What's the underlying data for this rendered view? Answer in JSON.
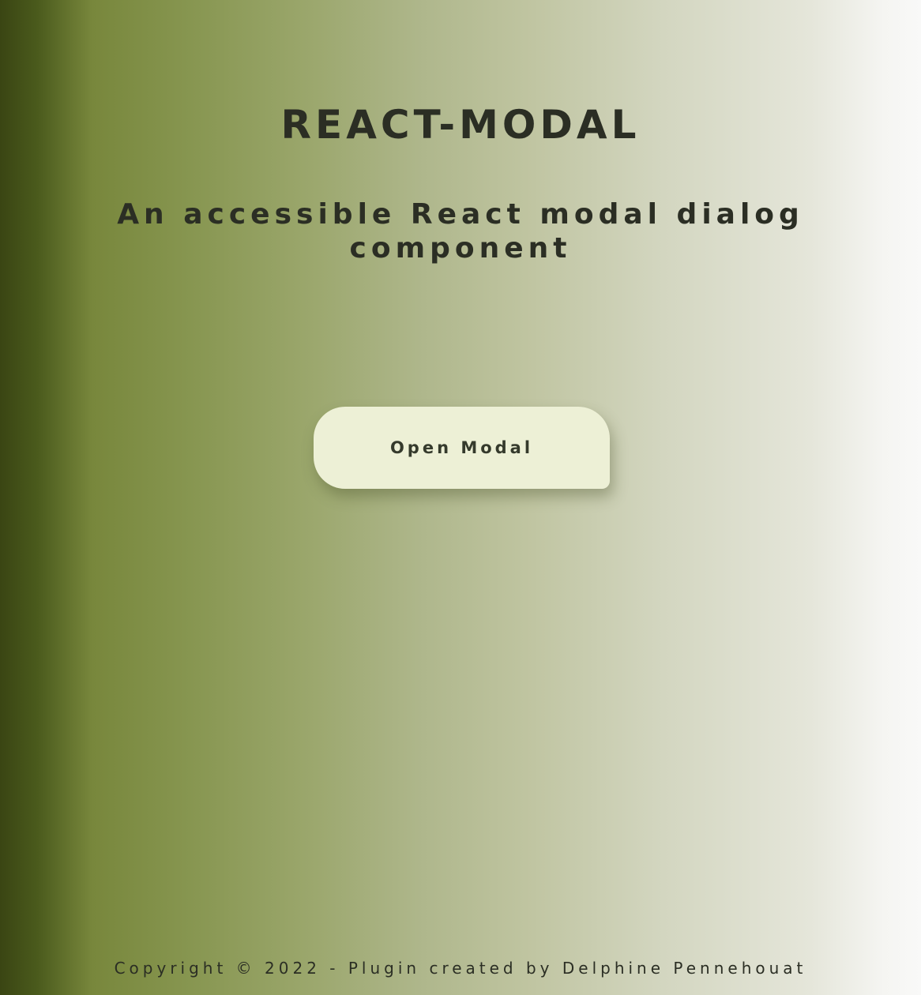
{
  "header": {
    "title": "REACT-MODAL",
    "subtitle": "An accessible React modal dialog component"
  },
  "main": {
    "open_modal_label": "Open Modal"
  },
  "footer": {
    "copyright": "Copyright © 2022 - Plugin created by Delphine Pennehouat"
  },
  "colors": {
    "background_gradient_start": "#3a4513",
    "background_gradient_end": "#f9f9f8",
    "button_background": "#edf0d6",
    "text": "#2b2e24"
  }
}
